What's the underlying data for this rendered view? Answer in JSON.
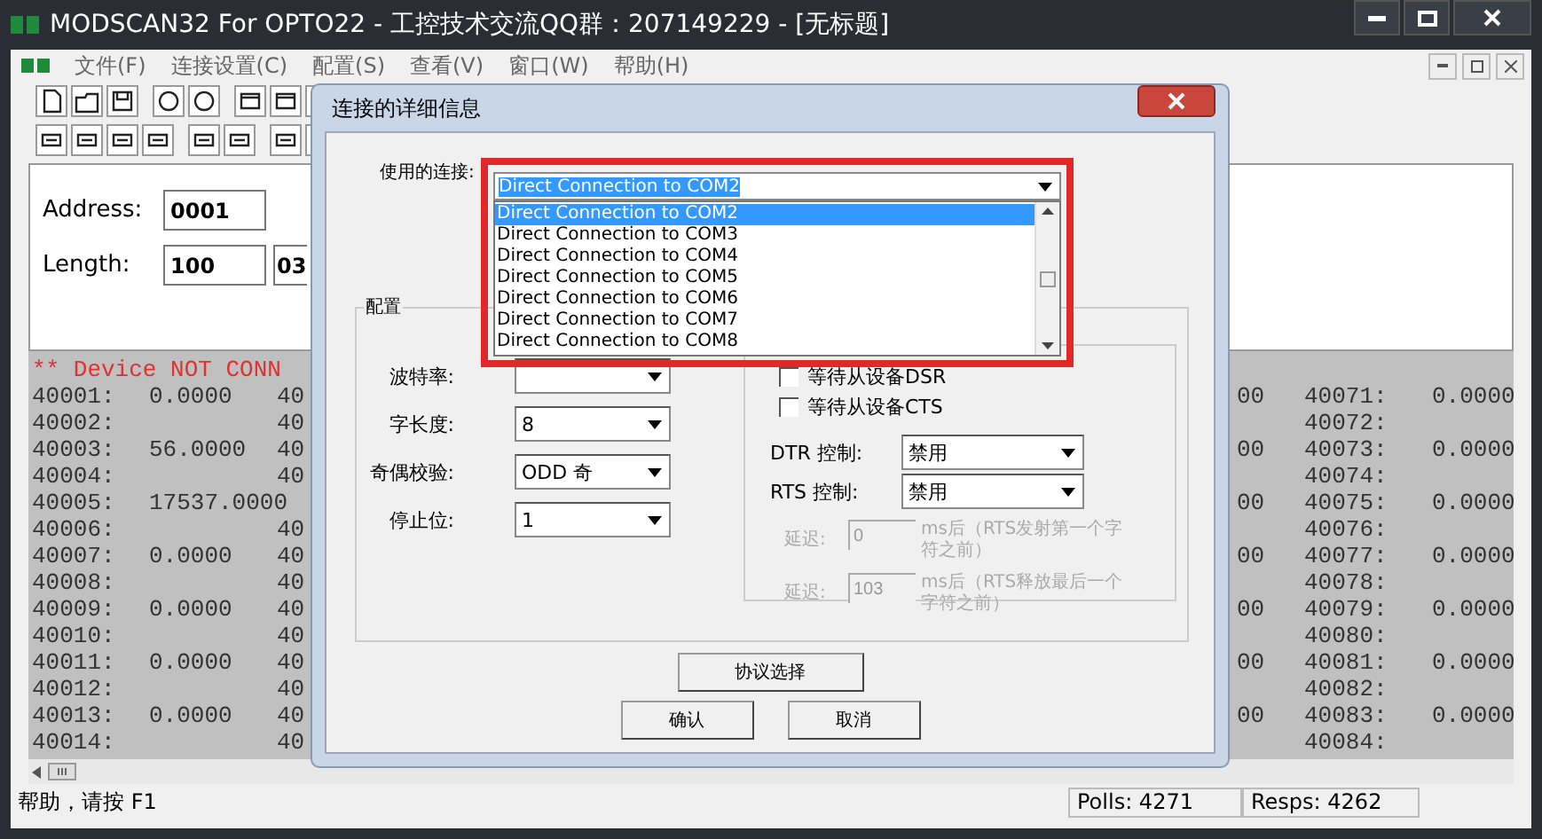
{
  "window": {
    "title": "MODSCAN32 For OPTO22 - 工控技术交流QQ群：207149229 - [无标题]"
  },
  "menu": [
    "文件(F)",
    "连接设置(C)",
    "配置(S)",
    "查看(V)",
    "窗口(W)",
    "帮助(H)"
  ],
  "inputs": [
    {
      "label": "Address:",
      "value": "0001"
    },
    {
      "label": "Length:",
      "value": "100"
    }
  ],
  "cut_field": {
    "value": "03"
  },
  "banner": "** Device NOT CONN",
  "left_rows": [
    {
      "address": "40001:",
      "value": "0.0000",
      "tail": "40"
    },
    {
      "address": "40002:",
      "tail": "40"
    },
    {
      "address": "40003:",
      "value": "56.0000",
      "tail": "40"
    },
    {
      "address": "40004:",
      "tail": "40"
    },
    {
      "address": "40005:",
      "value": "17537.0000"
    },
    {
      "address": "40006:",
      "tail": "40"
    },
    {
      "address": "40007:",
      "value": "0.0000",
      "tail": "40"
    },
    {
      "address": "40008:",
      "tail": "40"
    },
    {
      "address": "40009:",
      "value": "0.0000",
      "tail": "40"
    },
    {
      "address": "40010:",
      "tail": "40"
    },
    {
      "address": "40011:",
      "value": "0.0000",
      "tail": "40"
    },
    {
      "address": "40012:",
      "tail": "40"
    },
    {
      "address": "40013:",
      "value": "0.0000",
      "tail": "40"
    },
    {
      "address": "40014:",
      "tail": "40"
    }
  ],
  "right_rows": [
    {
      "head": "00",
      "address": "40071:",
      "value": "0.0000"
    },
    {
      "address": "40072:"
    },
    {
      "head": "00",
      "address": "40073:",
      "value": "0.0000"
    },
    {
      "address": "40074:"
    },
    {
      "head": "00",
      "address": "40075:",
      "value": "0.0000"
    },
    {
      "address": "40076:"
    },
    {
      "head": "00",
      "address": "40077:",
      "value": "0.0000"
    },
    {
      "address": "40078:"
    },
    {
      "head": "00",
      "address": "40079:",
      "value": "0.0000"
    },
    {
      "address": "40080:"
    },
    {
      "head": "00",
      "address": "40081:",
      "value": "0.0000"
    },
    {
      "address": "40082:"
    },
    {
      "head": "00",
      "address": "40083:",
      "value": "0.0000"
    },
    {
      "address": "40084:"
    }
  ],
  "status_bar": {
    "help": "帮助，请按 F1",
    "polls": "Polls: 4271",
    "resps": "Resps: 4262"
  },
  "dialog": {
    "title": "连接的详细信息",
    "connection_label": "使用的连接:",
    "connection_value": "Direct Connection to COM2",
    "connection_options": [
      {
        "label": "Direct Connection to COM2",
        "selected": true
      },
      {
        "label": "Direct Connection to COM3",
        "selected": false
      },
      {
        "label": "Direct Connection to COM4",
        "selected": false
      },
      {
        "label": "Direct Connection to COM5",
        "selected": false
      },
      {
        "label": "Direct Connection to COM6",
        "selected": false
      },
      {
        "label": "Direct Connection to COM7",
        "selected": false
      },
      {
        "label": "Direct Connection to COM8",
        "selected": false
      }
    ],
    "group_title": "配置",
    "serial_fields": [
      {
        "label": "波特率:"
      },
      {
        "label": "字长度:",
        "value": "8"
      },
      {
        "label": "奇偶校验:",
        "value": "ODD 奇"
      },
      {
        "label": "停止位:",
        "value": "1"
      }
    ],
    "checks": [
      {
        "label": "等待从设备DSR",
        "checked": false
      },
      {
        "label": "等待从设备CTS",
        "checked": false
      }
    ],
    "controls": [
      {
        "label": "DTR 控制:",
        "value": "禁用"
      },
      {
        "label": "RTS 控制:",
        "value": "禁用"
      }
    ],
    "delays": [
      {
        "label": "延迟:",
        "value": "0",
        "note": "ms后（RTS发射第一个字符之前）",
        "disabled": true
      },
      {
        "label": "延迟:",
        "value": "103",
        "note": "ms后（RTS释放最后一个字符之前）",
        "disabled": true
      }
    ],
    "protocol_button": "协议选择",
    "ok_button": "确认",
    "cancel_button": "取消"
  }
}
